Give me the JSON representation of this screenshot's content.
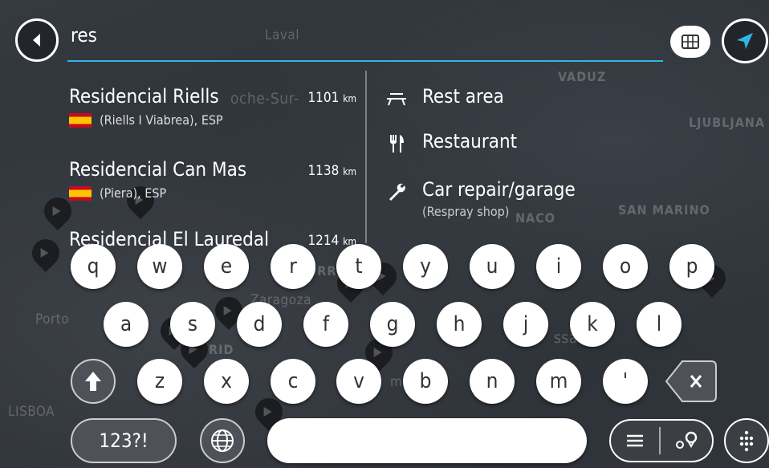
{
  "search": {
    "query": "res"
  },
  "map_labels": {
    "laval": "Laval",
    "vaduz": "VADUZ",
    "ljubljana": "LJUBLJANA",
    "san_marino": "SAN MARINO",
    "porto": "Porto",
    "lisboa": "LISBOA",
    "zaragoza": "Zaragoza",
    "roche_sur": "oche-Sur-",
    "naco": "NACO",
    "orr": "ORR",
    "ssa": "ssa",
    "ma": "ma",
    "rid": "RID"
  },
  "results": [
    {
      "name": "Residencial Riells",
      "distance": "1101",
      "unit": "km",
      "location": "(Riells I Viabrea), ESP"
    },
    {
      "name": "Residencial Can Mas",
      "distance": "1138",
      "unit": "km",
      "location": "(Piera), ESP"
    },
    {
      "name": "Residencial El Lauredal",
      "distance": "1214",
      "unit": "km"
    }
  ],
  "categories": [
    {
      "label": "Rest area",
      "icon": "rest-area-icon"
    },
    {
      "label": "Restaurant",
      "icon": "restaurant-icon"
    },
    {
      "label": "Car repair/garage",
      "sublabel": "(Respray shop)",
      "icon": "wrench-icon"
    }
  ],
  "keyboard": {
    "row1": [
      "q",
      "w",
      "e",
      "r",
      "t",
      "y",
      "u",
      "i",
      "o",
      "p"
    ],
    "row2": [
      "a",
      "s",
      "d",
      "f",
      "g",
      "h",
      "j",
      "k",
      "l"
    ],
    "row3": [
      "z",
      "x",
      "c",
      "v",
      "b",
      "n",
      "m",
      "'"
    ],
    "numbers_label": "123?!"
  },
  "colors": {
    "accent": "#2fb6e6",
    "background": "#2f3338",
    "key": "#ffffff"
  }
}
